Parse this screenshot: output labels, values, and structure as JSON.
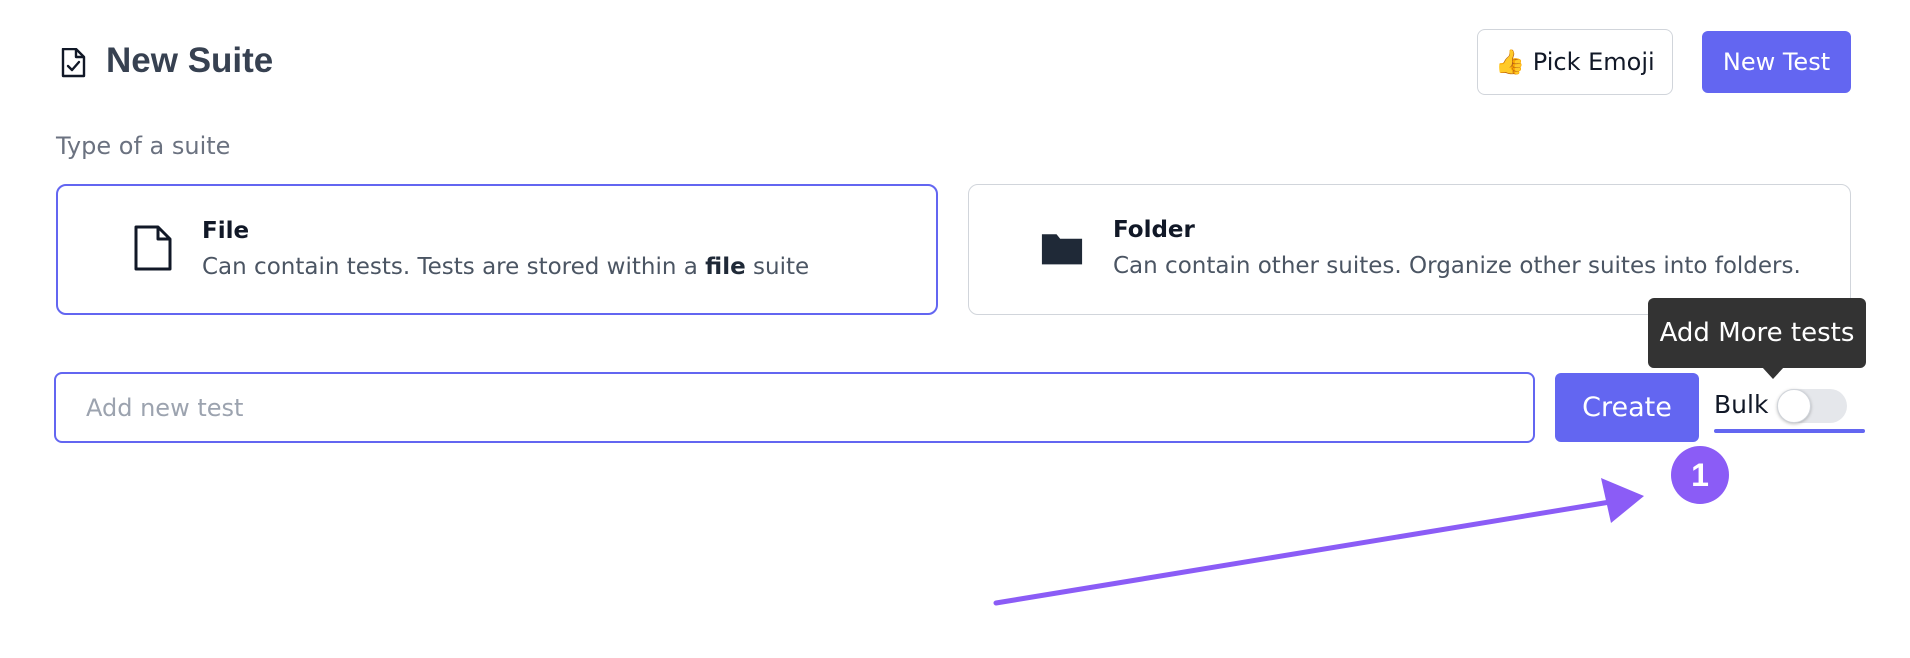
{
  "header": {
    "title": "New Suite",
    "title_icon": "file-check-icon",
    "pick_emoji_label": "👍 Pick Emoji",
    "new_test_label": "New Test"
  },
  "suite_type": {
    "label": "Type of a suite",
    "options": [
      {
        "icon": "file-icon",
        "title": "File",
        "description_prefix": "Can contain tests. Tests are stored within a ",
        "description_bold": "file",
        "description_suffix": " suite",
        "selected": true
      },
      {
        "icon": "folder-icon",
        "title": "Folder",
        "description": "Can contain other suites. Organize other suites into folders.",
        "selected": false
      }
    ]
  },
  "add_test": {
    "placeholder": "Add new test",
    "value": "",
    "create_label": "Create",
    "bulk_label": "Bulk",
    "bulk_enabled": false,
    "tooltip": "Add More tests"
  },
  "annotation": {
    "step_number": "1",
    "color": "#8b5cf6"
  },
  "colors": {
    "accent": "#6366f1",
    "tooltip_bg": "#333333"
  }
}
